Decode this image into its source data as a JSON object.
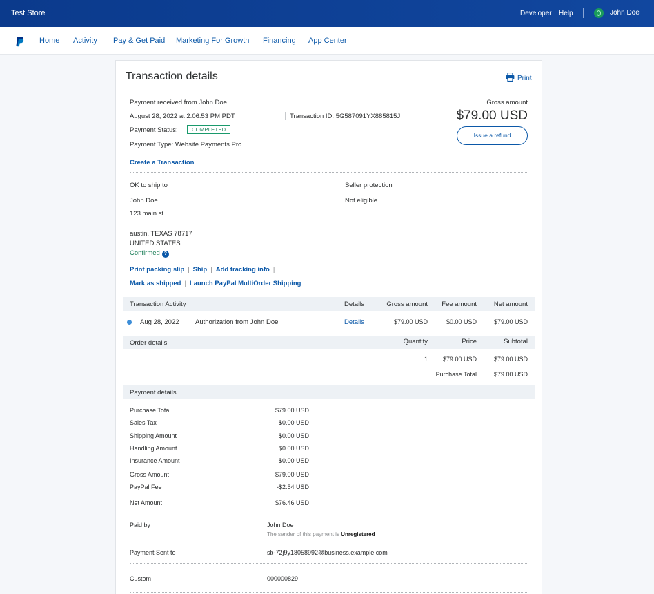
{
  "topbar": {
    "store_name": "Test Store",
    "developer": "Developer",
    "help": "Help",
    "user_name": "John Doe"
  },
  "nav": {
    "items": [
      "Home",
      "Activity",
      "Pay & Get Paid",
      "Marketing For Growth",
      "Financing",
      "App Center"
    ]
  },
  "details": {
    "title": "Transaction details",
    "print": "Print",
    "received_from": "Payment received from John Doe",
    "datetime": "August 28, 2022 at 2:06:53 PM PDT",
    "txn_id": "Transaction ID: 5G587091YX885815J",
    "status_label": "Payment Status:",
    "status": "COMPLETED",
    "type": "Payment Type: Website Payments Pro",
    "create_txn": "Create a Transaction",
    "gross_label": "Gross amount",
    "gross_value": "$79.00 USD",
    "refund": "Issue a refund"
  },
  "shipping": {
    "ok_to_ship": "OK to ship to",
    "name": "John Doe",
    "street": "123 main st",
    "city": "austin, TEXAS 78717",
    "country": "UNITED STATES",
    "confirmed": "Confirmed",
    "help_glyph": "?",
    "seller_protection_label": "Seller protection",
    "seller_protection_value": "Not eligible",
    "links": [
      "Print packing slip",
      "Ship",
      "Add tracking info",
      "Mark as shipped",
      "Launch PayPal MultiOrder Shipping"
    ]
  },
  "activity": {
    "headers": [
      "Transaction Activity",
      "Details",
      "Gross amount",
      "Fee amount",
      "Net amount"
    ],
    "row": {
      "date": "Aug 28, 2022",
      "desc": "Authorization from John Doe",
      "details": "Details",
      "gross": "$79.00 USD",
      "fee": "$0.00 USD",
      "net": "$79.00 USD"
    }
  },
  "order": {
    "headers": [
      "Order details",
      "Quantity",
      "Price",
      "Subtotal"
    ],
    "row": {
      "qty": "1",
      "price": "$79.00 USD",
      "subtotal": "$79.00 USD"
    },
    "total_label": "Purchase Total",
    "total_value": "$79.00 USD"
  },
  "payment": {
    "header": "Payment details",
    "rows": [
      {
        "label": "Purchase Total",
        "value": "$79.00 USD"
      },
      {
        "label": "Sales Tax",
        "value": "$0.00 USD"
      },
      {
        "label": "Shipping Amount",
        "value": "$0.00 USD"
      },
      {
        "label": "Handling Amount",
        "value": "$0.00 USD"
      },
      {
        "label": "Insurance Amount",
        "value": "$0.00 USD"
      },
      {
        "label": "Gross Amount",
        "value": "$79.00 USD"
      },
      {
        "label": "PayPal Fee",
        "value": "-$2.54 USD"
      },
      {
        "label": "Net Amount",
        "value": "$76.46 USD"
      }
    ],
    "paid_by_label": "Paid by",
    "paid_by_value": "John Doe",
    "sender_note": "The sender of this payment is ",
    "sender_status": "Unregistered",
    "sent_to_label": "Payment Sent to",
    "sent_to_value": "sb-72j9y18058992@business.example.com",
    "custom_label": "Custom",
    "custom_value": "000000829"
  },
  "colors": {
    "topbar": "#0c3d8f",
    "link": "#0b58a8",
    "status_green": "#1a7d57"
  }
}
